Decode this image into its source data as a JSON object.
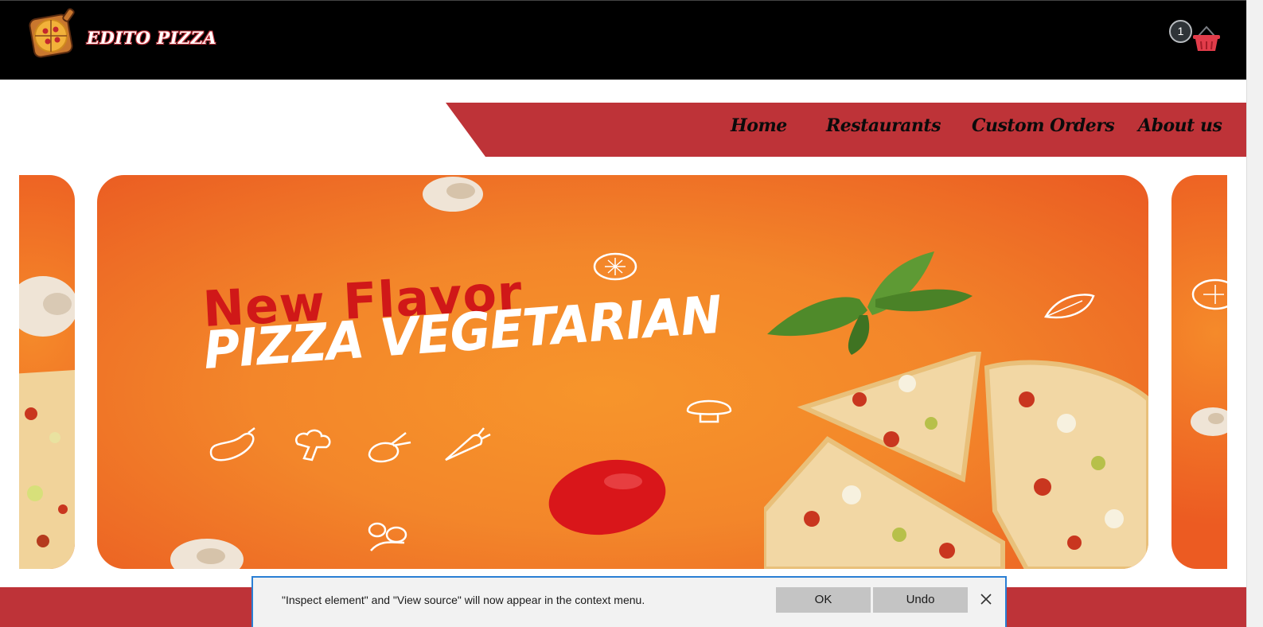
{
  "header": {
    "brand": "EDITO PIZZA",
    "cart_count": "1",
    "logo_icon": "pizza-board-icon",
    "cart_icon": "shopping-basket-icon"
  },
  "nav": {
    "items": [
      {
        "label": "Home"
      },
      {
        "label": "Restaurants"
      },
      {
        "label": "Custom Orders"
      },
      {
        "label": "About us"
      }
    ]
  },
  "hero": {
    "line1": "New Flavor",
    "line2": "PIZZA VEGETARIAN"
  },
  "notification": {
    "message": "\"Inspect element\" and \"View source\" will now appear in the context menu.",
    "ok_label": "OK",
    "undo_label": "Undo",
    "close_icon": "close-icon"
  },
  "colors": {
    "header_bg": "#000000",
    "nav_red": "#be3338",
    "hero_orange": "#f3862a",
    "dialog_border": "#2a7fd4"
  }
}
